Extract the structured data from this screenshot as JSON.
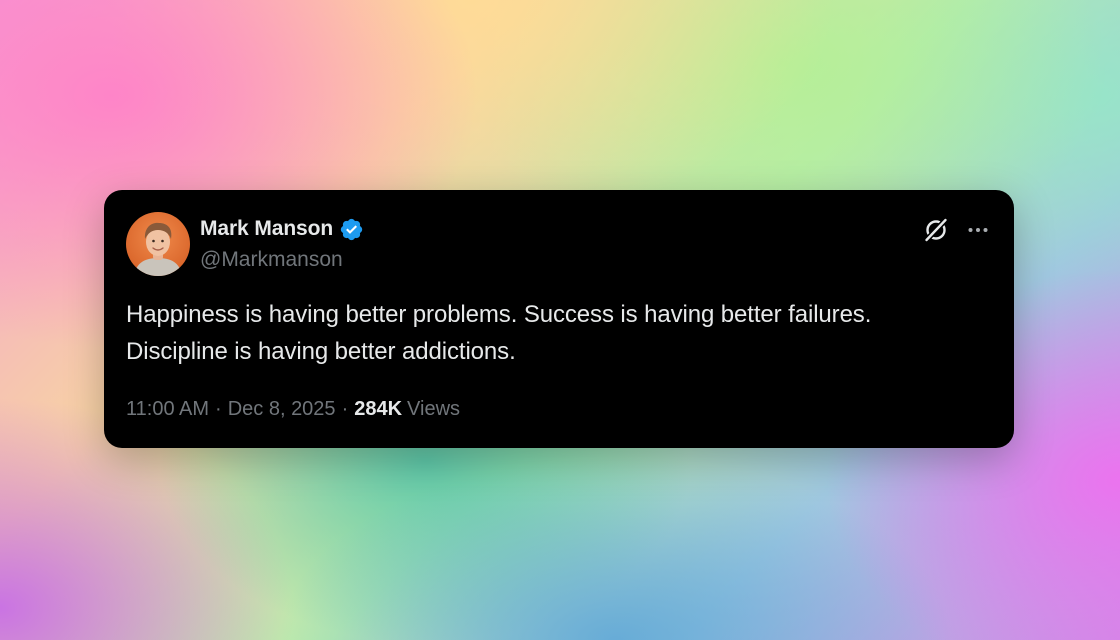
{
  "tweet": {
    "author": {
      "name": "Mark Manson",
      "handle": "@Markmanson",
      "verified": true,
      "avatar_icon": "avatar-photo"
    },
    "text_lines": [
      "Happiness is having better problems. Success is having better failures.",
      "Discipline is having better addictions."
    ],
    "time": "11:00 AM",
    "date": "Dec 8, 2025",
    "separator": "·",
    "views_count": "284K",
    "views_label": "Views"
  },
  "icons": {
    "verified": "verified-badge-icon",
    "grok": "grok-icon",
    "more": "more-options-icon"
  },
  "colors": {
    "card_background": "#000000",
    "primary_text": "#e7e9ea",
    "secondary_text": "#71767b",
    "verified_blue": "#1d9bf0",
    "avatar_background": "#e8793d"
  }
}
